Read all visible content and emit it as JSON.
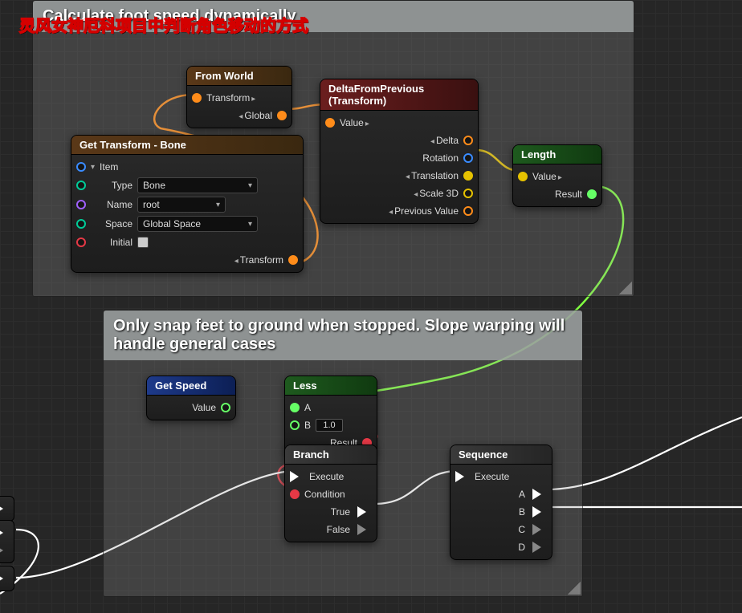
{
  "watermark": "灵风女神厄科项目中判断角色移动的方式",
  "comments": {
    "top": {
      "title": "Calculate foot speed dynamically"
    },
    "bottom": {
      "title": "Only snap feet to ground when stopped. Slope warping will handle general cases"
    }
  },
  "nodes": {
    "fromWorld": {
      "title": "From World",
      "pin_transform": "Transform",
      "out_global": "Global"
    },
    "getTransformBone": {
      "title": "Get Transform - Bone",
      "in_item": "Item",
      "type_label": "Type",
      "type_value": "Bone",
      "name_label": "Name",
      "name_value": "root",
      "space_label": "Space",
      "space_value": "Global Space",
      "initial_label": "Initial",
      "out_transform": "Transform"
    },
    "deltaFromPrevious": {
      "title": "DeltaFromPrevious (Transform)",
      "in_value": "Value",
      "out_delta": "Delta",
      "out_rotation": "Rotation",
      "out_translation": "Translation",
      "out_scale": "Scale 3D",
      "out_previous": "Previous Value"
    },
    "length": {
      "title": "Length",
      "in_value": "Value",
      "out_result": "Result"
    },
    "getSpeed": {
      "title": "Get Speed",
      "out_value": "Value"
    },
    "less": {
      "title": "Less",
      "in_a": "A",
      "in_b": "B",
      "b_value": "1.0",
      "out_result": "Result"
    },
    "branch": {
      "title": "Branch",
      "in_execute": "Execute",
      "in_condition": "Condition",
      "out_true": "True",
      "out_false": "False"
    },
    "sequence": {
      "title": "Sequence",
      "in_execute": "Execute",
      "out_a": "A",
      "out_b": "B",
      "out_c": "C",
      "out_d": "D"
    }
  }
}
